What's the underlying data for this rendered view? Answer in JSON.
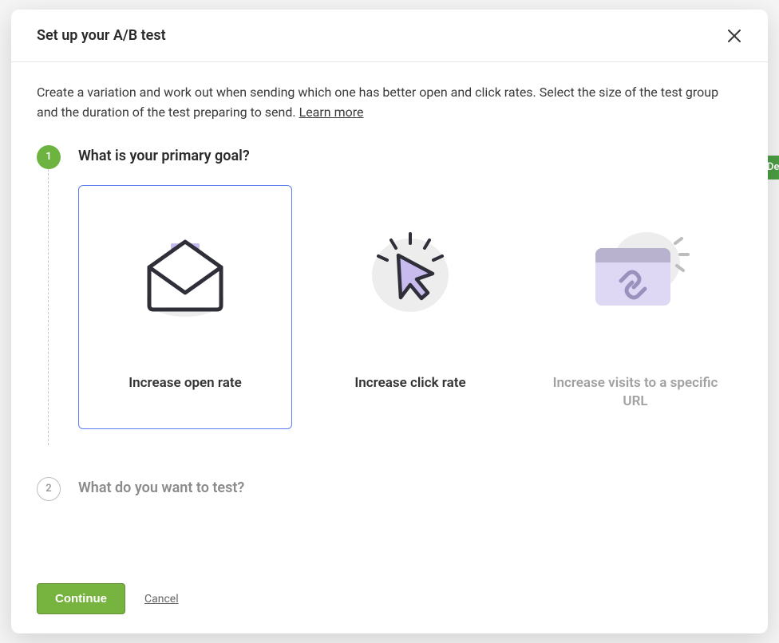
{
  "modal": {
    "title": "Set up your A/B test",
    "intro_text": "Create a variation and work out when sending which one has better open and click rates. Select the size of the test group and the duration of the test preparing to send. ",
    "learn_more_label": "Learn more",
    "steps": [
      {
        "number": "1",
        "heading": "What is your primary goal?",
        "active": true,
        "options": [
          {
            "label": "Increase open rate",
            "icon": "envelope-open-icon",
            "selected": true
          },
          {
            "label": "Increase click rate",
            "icon": "cursor-click-icon",
            "selected": false
          },
          {
            "label": "Increase visits to a specific URL",
            "icon": "browser-link-icon",
            "selected": false,
            "disabled": true
          }
        ]
      },
      {
        "number": "2",
        "heading": "What do you want to test?",
        "active": false
      }
    ],
    "footer": {
      "continue_label": "Continue",
      "cancel_label": "Cancel"
    }
  },
  "background": {
    "peek_text": "De"
  },
  "colors": {
    "accent_green": "#6db33f",
    "selected_border": "#5c7ff0",
    "lavender": "#c8bbed"
  }
}
